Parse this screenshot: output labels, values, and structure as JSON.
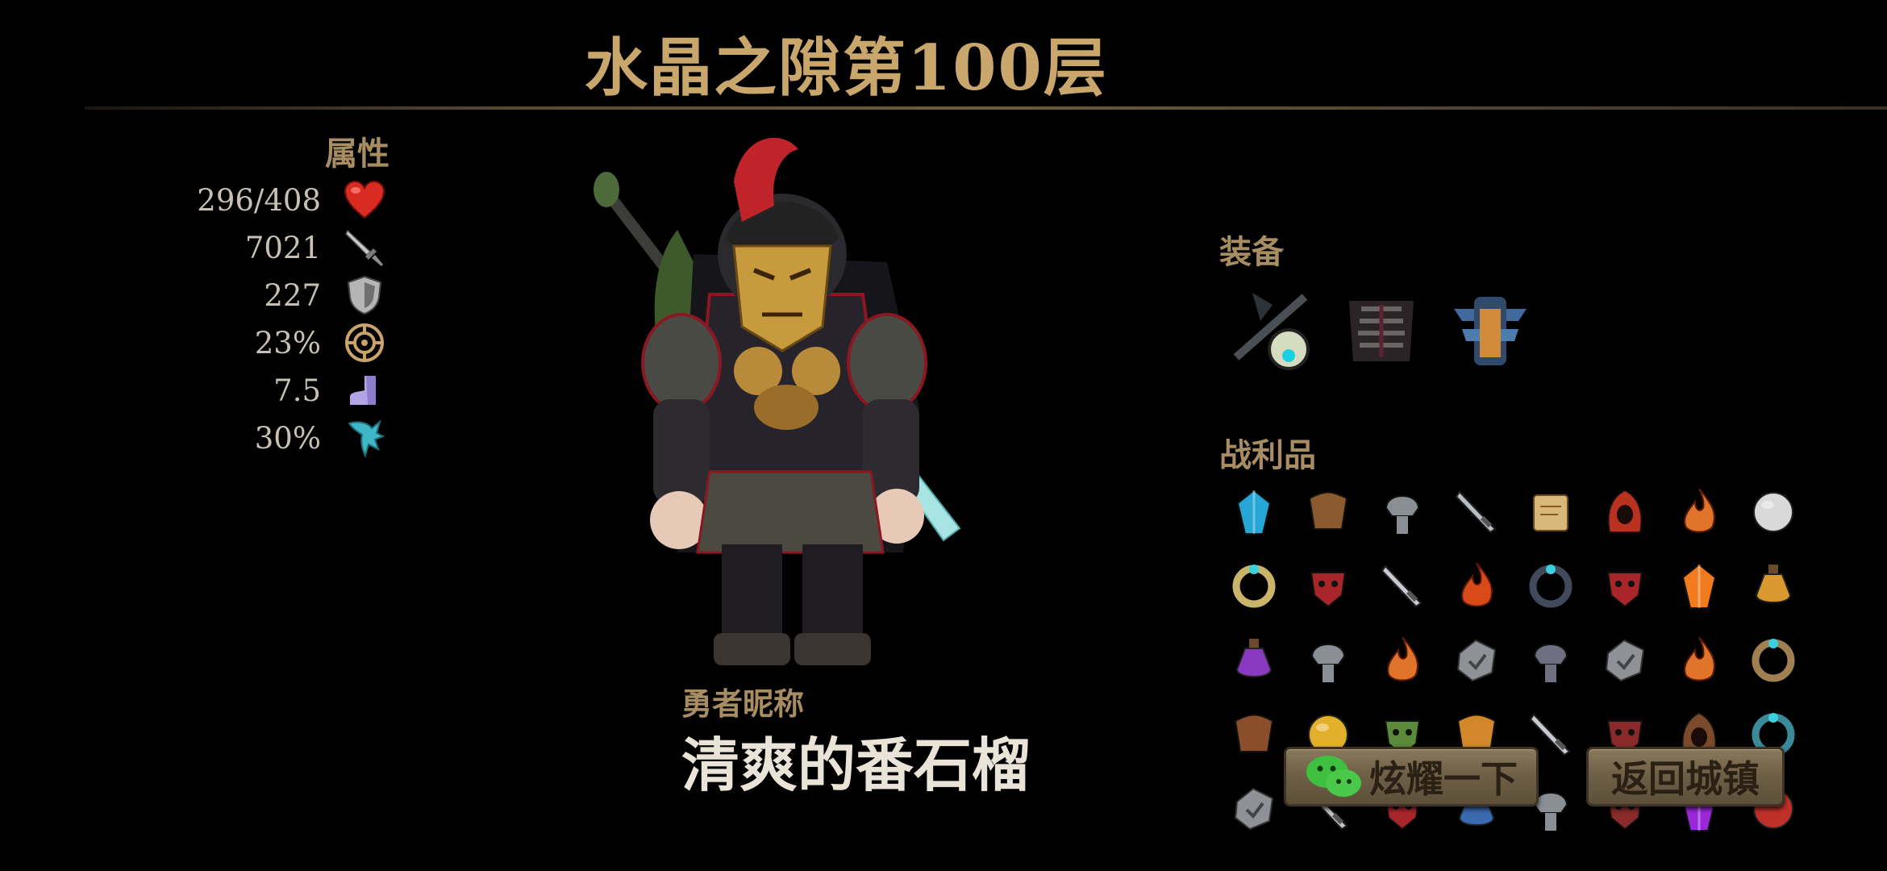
{
  "header": {
    "title": "水晶之隙第100层"
  },
  "attributes": {
    "label": "属性",
    "stats": [
      {
        "value": "296/408",
        "icon": "heart-icon"
      },
      {
        "value": "7021",
        "icon": "sword-icon"
      },
      {
        "value": "227",
        "icon": "shield-icon"
      },
      {
        "value": "23%",
        "icon": "critical-icon"
      },
      {
        "value": "7.5",
        "icon": "boot-icon"
      },
      {
        "value": "30%",
        "icon": "splash-icon"
      }
    ]
  },
  "hero": {
    "nickname_label": "勇者昵称",
    "nickname": "清爽的番石榴"
  },
  "equipment": {
    "label": "装备",
    "items": [
      "weapon-staff-icon",
      "chest-armor-icon",
      "pauldron-icon"
    ]
  },
  "loot": {
    "label": "战利品",
    "rows": [
      [
        "blue-crystal-icon",
        "fur-cape-icon",
        "iron-helm-icon",
        "curved-dagger-icon",
        "scroll-map-icon",
        "red-hood-icon",
        "flame-amulet-icon",
        "crowned-orb-icon"
      ],
      [
        "star-ring-icon",
        "red-mask-icon",
        "spike-blade-icon",
        "fire-gem-icon",
        "eye-ring-icon",
        "red-mask-icon",
        "orange-crystal-icon",
        "gold-potion-icon"
      ],
      [
        "purple-amulet-icon",
        "iron-helm-icon",
        "flame-amulet-icon",
        "stone-rune-icon",
        "steel-gauntlet-icon",
        "stone-rune-icon",
        "flame-amulet-icon",
        "gold-bracelet-icon"
      ],
      [
        "leather-pouch-icon",
        "gold-coin-icon",
        "goblin-head-icon",
        "gold-crown-icon",
        "silver-claw-icon",
        "horned-mask-icon",
        "brown-hood-icon",
        "teal-ring-icon"
      ],
      [
        "stone-rune-icon",
        "silver-dagger-icon",
        "red-mask-icon",
        "blue-goblet-icon",
        "iron-helm-icon",
        "horned-mask-icon",
        "purple-crystal-icon",
        "red-orb-icon"
      ]
    ]
  },
  "buttons": {
    "share": "炫耀一下",
    "return": "返回城镇"
  },
  "colors": {
    "title_gold": "#c9a66b",
    "label_bronze": "#a98d62",
    "wechat_green": "#3fbf3f"
  }
}
